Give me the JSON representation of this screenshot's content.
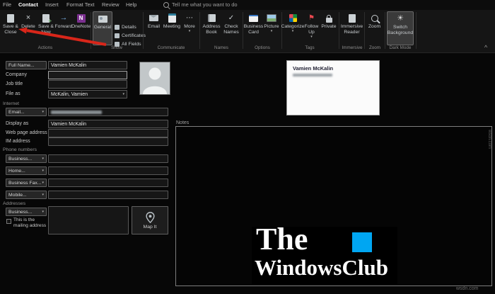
{
  "menubar": {
    "tabs": [
      {
        "label": "File"
      },
      {
        "label": "Contact"
      },
      {
        "label": "Insert"
      },
      {
        "label": "Format Text"
      },
      {
        "label": "Review"
      },
      {
        "label": "Help"
      }
    ],
    "tell_me": "Tell me what you want to do"
  },
  "ribbon": {
    "actions": {
      "label": "Actions",
      "save_close": "Save & Close",
      "delete": "Delete",
      "save_new": "Save & New",
      "forward": "Forward",
      "onenote": "OneNote"
    },
    "show": {
      "label": "Show",
      "general": "General",
      "details": "Details",
      "certificates": "Certificates",
      "all_fields": "All Fields"
    },
    "communicate": {
      "label": "Communicate",
      "email": "Email",
      "meeting": "Meeting",
      "more": "More"
    },
    "names": {
      "label": "Names",
      "address_book": "Address Book",
      "check_names": "Check Names"
    },
    "options": {
      "label": "Options",
      "business_card": "Business Card",
      "picture": "Picture"
    },
    "tags": {
      "label": "Tags",
      "categorize": "Categorize",
      "follow_up": "Follow Up",
      "private": "Private"
    },
    "immersive": {
      "label": "Immersive",
      "reader": "Immersive Reader"
    },
    "zoom": {
      "label": "Zoom",
      "zoom": "Zoom"
    },
    "dark_mode": {
      "label": "Dark Mode",
      "switch_background": "Switch Background"
    }
  },
  "form": {
    "full_name_button": "Full Name...",
    "full_name_value": "Vamien McKalin",
    "company_label": "Company",
    "job_title_label": "Job title",
    "file_as_label": "File as",
    "file_as_value": "McKalin, Vamien",
    "internet_section": "Internet",
    "email_button": "Email...",
    "display_as_label": "Display as",
    "display_as_value": "Vamien McKalin",
    "web_page_label": "Web page address",
    "im_label": "IM address",
    "phone_section": "Phone numbers",
    "phone_business": "Business...",
    "phone_home": "Home...",
    "phone_fax": "Business Fax...",
    "phone_mobile": "Mobile...",
    "addresses_section": "Addresses",
    "address_business": "Business...",
    "mailing_label": "This is the mailing address",
    "map_button": "Map It"
  },
  "business_card": {
    "name": "Vamien McKalin"
  },
  "notes": {
    "label": "Notes"
  },
  "logo": {
    "the": "The",
    "club": "WindowsClub",
    "accent_color": "#00a6f2"
  },
  "icons": {
    "delete_x": "×",
    "forward_arrow": "→",
    "more_ellipsis": "⋯",
    "check": "✓",
    "flag": "⚑",
    "sun": "☀",
    "caret": "▾",
    "collapse": "^",
    "onenote_n": "N"
  },
  "annotation": {
    "arrow_color": "#d8261a"
  },
  "watermarks": {
    "side": "wsdn.com",
    "corner": "wsdn.com"
  }
}
